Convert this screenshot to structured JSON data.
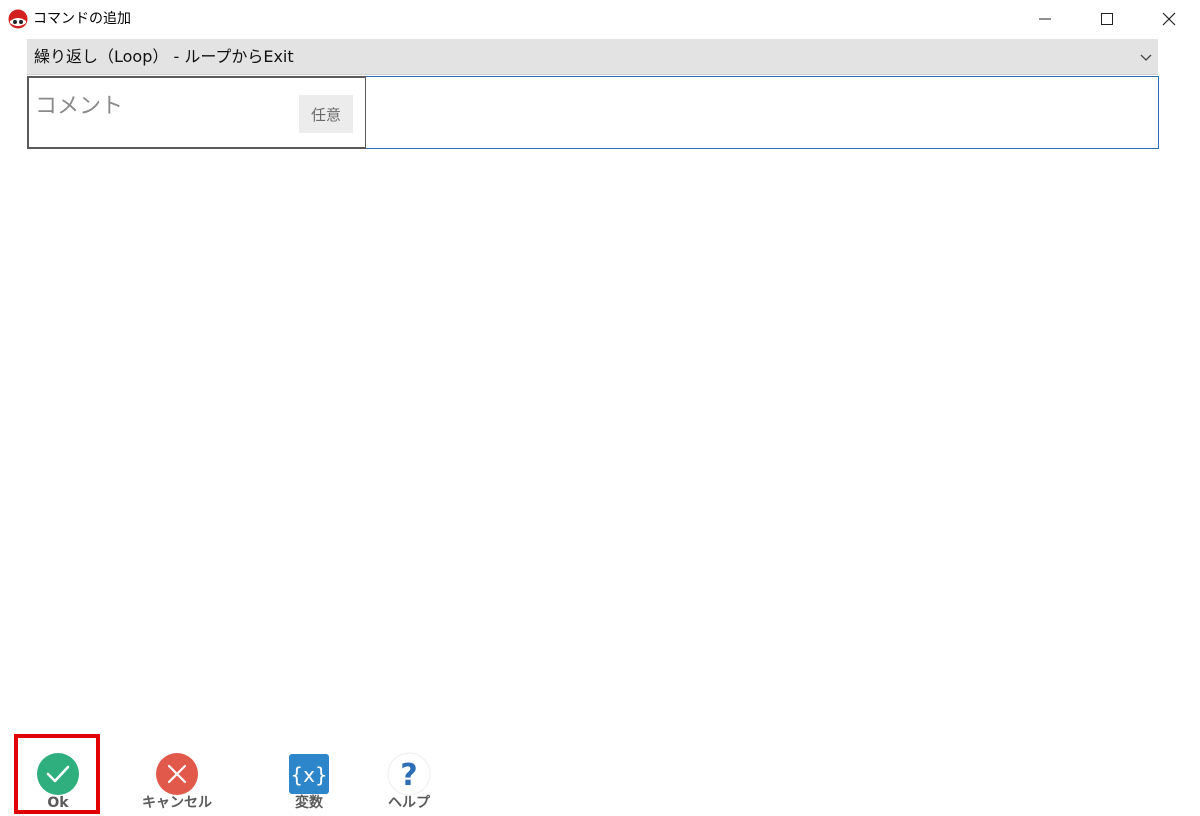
{
  "window": {
    "title": "コマンドの追加",
    "icons": {
      "app": "ladybug-logo-icon",
      "minimize": "minimize-icon",
      "maximize": "maximize-icon",
      "close": "close-icon"
    }
  },
  "command": {
    "selected": "繰り返し（Loop） - ループからExit",
    "chevron_icon": "chevron-down-icon"
  },
  "comment": {
    "label": "コメント",
    "badge": "任意",
    "value": ""
  },
  "toolbar": {
    "ok_label": "Ok",
    "cancel_label": "キャンセル",
    "variable_label": "変数",
    "help_label": "ヘルプ",
    "variable_icon_text": "{x}",
    "help_icon_text": "?"
  },
  "colors": {
    "ok": "#2eaf7d",
    "cancel": "#e0594a",
    "variable": "#2c86c9",
    "help": "#2c6fb5",
    "highlight": "#e00000"
  }
}
